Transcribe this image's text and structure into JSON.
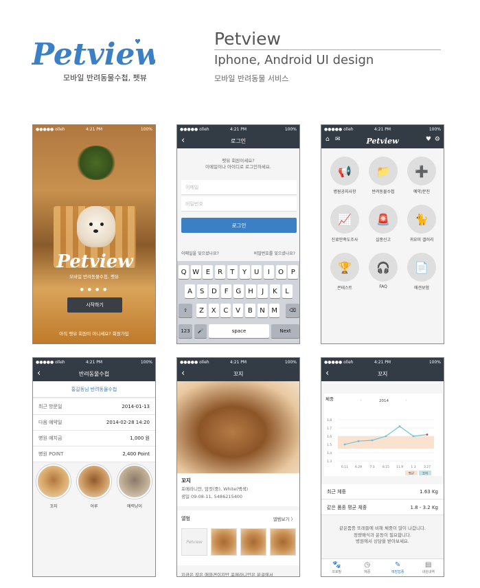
{
  "header": {
    "logo_text": "Petview",
    "logo_sub": "모바일 반려동물수첩, 펫뷰",
    "title": "Petview",
    "subtitle": "Iphone, Android UI design",
    "subtitle2": "모바일 반려동물 서비스"
  },
  "colors": {
    "brand_blue": "#3b7fc4",
    "navbar": "#333b44",
    "accent_red": "#e23a3a"
  },
  "status": {
    "carrier": "●●●●● olleh",
    "time": "4:21 PM",
    "battery": "100%"
  },
  "splash": {
    "logo": "Petview",
    "tagline": "모바일 반려동물수첩, 펫뷰",
    "dots": "● ● ● ●",
    "start": "시작하기",
    "join_prompt": "아직 펫뷰 회원이 아니세요? 회원가입"
  },
  "login": {
    "title": "로그인",
    "msg1": "펫뷰 회원이세요?",
    "msg2": "이메일이나 아이디로 로그인하세요.",
    "email_placeholder": "이메일",
    "password_placeholder": "비밀번호",
    "login_button": "로그인",
    "forgot_email": "이메일을 잊으셨나요?",
    "forgot_password": "비밀번호를 잊으셨나요?",
    "row1": [
      "Q",
      "W",
      "E",
      "R",
      "T",
      "Y",
      "U",
      "I",
      "O",
      "P"
    ],
    "row2": [
      "A",
      "S",
      "D",
      "F",
      "G",
      "H",
      "J",
      "K",
      "L"
    ],
    "row3": [
      "Z",
      "X",
      "C",
      "V",
      "B",
      "N",
      "M"
    ],
    "num_key": "123",
    "mic_key": "🎤",
    "space_key": "space",
    "next_key": "Next",
    "shift_key": "⇧",
    "delete_key": "⌫"
  },
  "home": {
    "logo": "Petview",
    "tiles": [
      {
        "label": "병원공지사항",
        "icon": "megaphone-icon",
        "glyph": "📢"
      },
      {
        "label": "반려동물수첩",
        "icon": "folder-icon",
        "glyph": "📁"
      },
      {
        "label": "예약/문진",
        "icon": "medical-kit-icon",
        "glyph": "➕"
      },
      {
        "label": "진료만족도조사",
        "icon": "chart-icon",
        "glyph": "📈"
      },
      {
        "label": "실종신고",
        "icon": "siren-icon",
        "glyph": "🚨"
      },
      {
        "label": "귀요미 갤러리",
        "icon": "cat-icon",
        "glyph": "🐈"
      },
      {
        "label": "콘테스트",
        "icon": "trophy-icon",
        "glyph": "🏆"
      },
      {
        "label": "FAQ",
        "icon": "headset-icon",
        "glyph": "🎧"
      },
      {
        "label": "애견보험",
        "icon": "document-icon",
        "glyph": "📄"
      }
    ]
  },
  "notebook": {
    "title": "반려동물수첩",
    "clinic": "홍길동님 반려동물수첩",
    "rows": [
      {
        "k": "최근 방문일",
        "v": "2014-01-13"
      },
      {
        "k": "다음 예약일",
        "v": "2014-02-28  14:20"
      },
      {
        "k": "병원 예치금",
        "v": "1,000 원"
      },
      {
        "k": "병원 POINT",
        "v": "2,400 Point"
      }
    ],
    "pets": [
      "꼬지",
      "어루",
      "애력냥이"
    ]
  },
  "detail": {
    "title": "꼬지",
    "name": "꼬지",
    "info1": "포메라니안, 암컷(중), White(백색)",
    "info2": "생일 09-08-11, 5486215400",
    "album": "앨범",
    "album_more": "앨범보기 〉",
    "thumb_placeholder": "Petview",
    "footer": "지금은 작은 애와견이지만 포메라니안은 분굴에서"
  },
  "weight": {
    "title": "꼬지",
    "row1": {
      "k": "최근 체중",
      "v": "1.63 Kg"
    },
    "row2": {
      "k": "같은 품종 평균 체중",
      "v": "1.8 - 3.2 Kg"
    },
    "msg1": "같은품종 또래들에 비해 체중이 많이 나갑니다.",
    "msg2": "정량배식과 운동이 필요합니다.",
    "msg3": "병원에서 상담을 받아보세요.",
    "tabs": [
      {
        "label": "프로필",
        "glyph": "🐾"
      },
      {
        "label": "체중",
        "glyph": "◷"
      },
      {
        "label": "예방접종",
        "glyph": "✎"
      },
      {
        "label": "내원내역",
        "glyph": "▤"
      }
    ]
  },
  "chart_data": {
    "type": "line",
    "title": "체중",
    "year_label": "2014",
    "x": [
      "6.11",
      "6.29",
      "7.3",
      "8.15",
      "11.9",
      "1.3",
      "3.27"
    ],
    "series": [
      {
        "values": [
          1.5,
          1.54,
          1.55,
          1.6,
          1.72,
          1.6,
          1.62
        ]
      }
    ],
    "ylim": [
      1.3,
      1.8
    ],
    "yticks": [
      "1.8",
      "1.7",
      "1.6",
      "1.5",
      "1.4",
      "1.3"
    ],
    "band": [
      1.45,
      1.6
    ],
    "legend": [
      "평균",
      "꼬지"
    ],
    "grid": true,
    "line_color": "#6ec1da",
    "band_color": "#fbe2cf"
  }
}
